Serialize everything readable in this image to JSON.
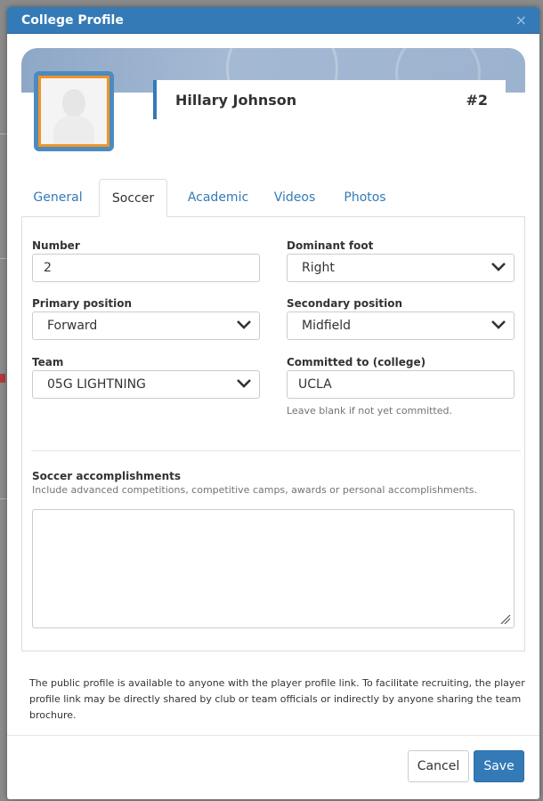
{
  "dialog": {
    "title": "College Profile",
    "close_symbol": "×"
  },
  "profile": {
    "name": "Hillary Johnson",
    "number_badge": "#2"
  },
  "tabs": [
    {
      "label": "General"
    },
    {
      "label": "Soccer",
      "active": true
    },
    {
      "label": "Academic"
    },
    {
      "label": "Videos"
    },
    {
      "label": "Photos"
    }
  ],
  "soccer": {
    "number_label": "Number",
    "number_value": "2",
    "dominant_foot_label": "Dominant foot",
    "dominant_foot_value": "Right",
    "primary_position_label": "Primary position",
    "primary_position_value": "Forward",
    "secondary_position_label": "Secondary position",
    "secondary_position_value": "Midfield",
    "team_label": "Team",
    "team_value": "05G LIGHTNING",
    "committed_label": "Committed to (college)",
    "committed_value": "UCLA",
    "committed_help": "Leave blank if not yet committed.",
    "accomplishments_label": "Soccer accomplishments",
    "accomplishments_help": "Include advanced competitions, competitive camps, awards or personal accomplishments.",
    "accomplishments_value": ""
  },
  "footer": {
    "note": "The public profile is available to anyone with the player profile link. To facilitate recruiting, the player profile link may be directly shared by club or team officials or indirectly by anyone sharing the team brochure.",
    "cancel_label": "Cancel",
    "save_label": "Save"
  },
  "colors": {
    "primary": "#337ab7",
    "avatar_border": "#f0932b"
  }
}
